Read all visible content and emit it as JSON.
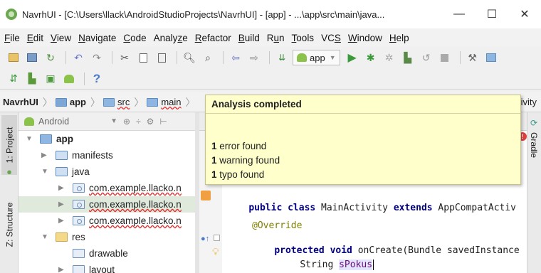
{
  "window": {
    "title": "NavrhUI - [C:\\Users\\llack\\AndroidStudioProjects\\NavrhUI] - [app] - ...\\app\\src\\main\\java...",
    "minimize": "—",
    "maximize": "☐",
    "close": "✕"
  },
  "menu": [
    {
      "u": "F",
      "rest": "ile"
    },
    {
      "u": "E",
      "rest": "dit"
    },
    {
      "u": "V",
      "rest": "iew"
    },
    {
      "u": "N",
      "rest": "avigate"
    },
    {
      "u": "C",
      "rest": "ode"
    },
    {
      "u": "",
      "rest": "Analy",
      "u2": "z",
      "rest2": "e"
    },
    {
      "u": "R",
      "rest": "efactor"
    },
    {
      "u": "B",
      "rest": "uild"
    },
    {
      "u": "",
      "rest": "R",
      "u2": "u",
      "rest2": "n"
    },
    {
      "u": "T",
      "rest": "ools"
    },
    {
      "u": "",
      "rest": "VC",
      "u2": "S",
      "rest2": ""
    },
    {
      "u": "W",
      "rest": "indow"
    },
    {
      "u": "H",
      "rest": "elp"
    }
  ],
  "toolbar": {
    "run_config": "app",
    "help": "?"
  },
  "breadcrumb": {
    "items": [
      "NavrhUI",
      "app",
      "src",
      "main"
    ],
    "trailing": "tivity"
  },
  "tool_windows": {
    "project": "1: Project",
    "structure": "Z: Structure",
    "gradle": "Gradle"
  },
  "project_panel": {
    "view": "Android",
    "tree": {
      "app": "app",
      "manifests": "manifests",
      "java": "java",
      "pkg1": "com.example.llacko.n",
      "pkg2": "com.example.llacko.n",
      "pkg3": "com.example.llacko.n",
      "res": "res",
      "drawable": "drawable",
      "layout": "layout"
    }
  },
  "editor": {
    "line_class": {
      "kw1": "public class",
      "name": " MainActivity ",
      "kw2": "extends",
      "rest": " AppCompatActiv"
    },
    "override": "@Override",
    "line_oncreate": {
      "kw": "protected void",
      "rest": " onCreate(Bundle savedInstance"
    },
    "line_field": {
      "type": "String ",
      "field": "sPokus"
    }
  },
  "analysis_popup": {
    "title": "Analysis completed",
    "errors": {
      "count": "1",
      "text": " error found"
    },
    "warnings": {
      "count": "1",
      "text": " warning found"
    },
    "typos": {
      "count": "1",
      "text": " typo found"
    }
  },
  "colors": {
    "popup_bg": "#ffffcc",
    "keyword": "#000080",
    "annotation": "#808000",
    "error": "#e03030"
  }
}
